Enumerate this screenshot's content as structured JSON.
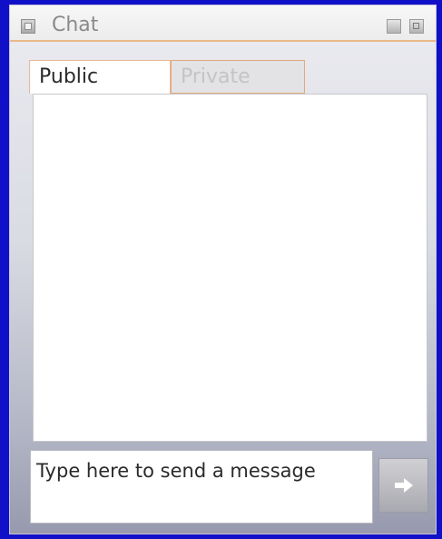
{
  "window": {
    "title": "Chat",
    "icon": "window-icon",
    "controls": [
      "minimize-icon",
      "maximize-icon"
    ]
  },
  "tabs": [
    {
      "label": "Public",
      "active": true
    },
    {
      "label": "Private",
      "active": false
    }
  ],
  "message_input": {
    "placeholder": "Type here to send a message"
  },
  "send_button": {
    "icon": "arrow-right-icon"
  },
  "colors": {
    "background": "#1010c8",
    "accent_border": "#e9b98a",
    "panel_gradient_top": "#ececf1",
    "panel_gradient_bottom": "#979aae"
  }
}
